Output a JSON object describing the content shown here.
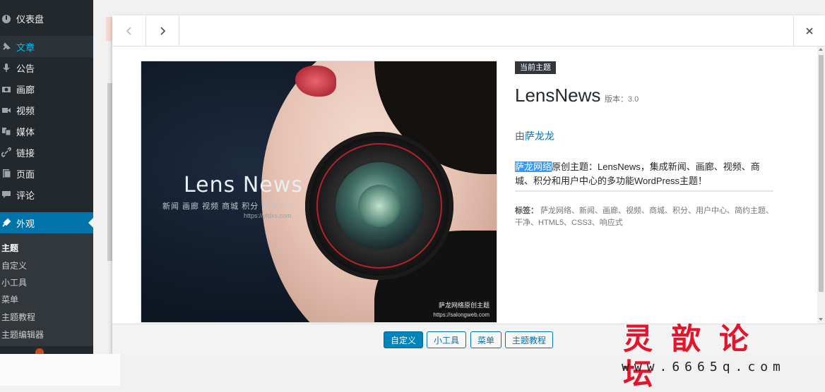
{
  "sidebar": {
    "items": [
      {
        "label": "仪表盘",
        "icon": "dashboard-icon"
      },
      {
        "label": "文章",
        "icon": "pin-icon"
      },
      {
        "label": "公告",
        "icon": "microphone-icon"
      },
      {
        "label": "画廊",
        "icon": "camera-icon"
      },
      {
        "label": "视频",
        "icon": "video-icon"
      },
      {
        "label": "媒体",
        "icon": "media-icon"
      },
      {
        "label": "链接",
        "icon": "link-icon"
      },
      {
        "label": "页面",
        "icon": "page-icon"
      },
      {
        "label": "评论",
        "icon": "comment-icon"
      },
      {
        "label": "外观",
        "icon": "brush-icon"
      }
    ],
    "submenu": [
      "主题",
      "自定义",
      "小工具",
      "菜单",
      "主题教程",
      "主题编辑器"
    ]
  },
  "modal": {
    "screenshot": {
      "brand": "Lens News",
      "tagline": "新闻 画廊 视频 商城 积分 用户中心",
      "url": "https://yfdxs.com",
      "signature": "萨龙网络原创主题",
      "signature_url": "https://salongweb.com"
    },
    "current_badge": "当前主题",
    "theme_name": "LensNews",
    "version": "版本：3.0",
    "author_prefix": "由",
    "author": "萨龙龙",
    "description_highlight": "萨龙网络",
    "description_rest": "原创主题：LensNews，集成新闻、画廊、视频、商城、积分和用户中心的多功能WordPress主题！",
    "tags_label": "标签：",
    "tags": "萨龙网络、新闻、画廊、视频、商城、积分、用户中心、简约主题、干净、HTML5、CSS3、响应式",
    "buttons": [
      "自定义",
      "小工具",
      "菜单",
      "主题教程"
    ]
  },
  "watermark": {
    "title": "灵歆论坛",
    "url": "www.6665q.com"
  },
  "colors": {
    "sidebar_bg": "#23282d",
    "accent": "#0073aa",
    "primary_button": "#0085ba",
    "watermark_red": "#e3142b"
  }
}
